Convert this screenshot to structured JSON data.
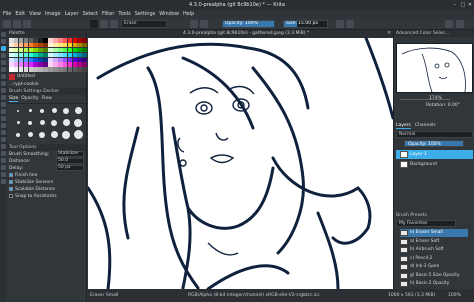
{
  "window": {
    "title": "4.3.0-prealpha (git 8c9b10e) * — Krita"
  },
  "menu": [
    "File",
    "Edit",
    "View",
    "Image",
    "Layer",
    "Select",
    "Filter",
    "Tools",
    "Settings",
    "Window",
    "Help"
  ],
  "toolbar": {
    "blend_mode": "Erase",
    "opacity_label": "Opacity: 100%",
    "opacity_value": 1.0,
    "size_label": "Size: 15.00 px",
    "size_fraction": 0.3
  },
  "left_docker": {
    "palette_title": "Palette",
    "palette_name": "Default",
    "palette_colors": [
      "#e0e0e0",
      "#c0c0c0",
      "#a0a0a0",
      "#808080",
      "#606060",
      "#404040",
      "#202020",
      "#000000",
      "#ffd5d5",
      "#ffaaaa",
      "#ff8080",
      "#ff5555",
      "#ff2a2a",
      "#d40000",
      "#aa0000",
      "#800000",
      "#ffe6d5",
      "#ffccaa",
      "#ffb380",
      "#ff9955",
      "#ff7f2a",
      "#d45500",
      "#aa4400",
      "#803300",
      "#fff6d5",
      "#ffeeaa",
      "#ffe680",
      "#ffdd55",
      "#ffd42a",
      "#d4aa00",
      "#aa8800",
      "#806600",
      "#eeffd5",
      "#ddffaa",
      "#ccff80",
      "#bbff55",
      "#aaff2a",
      "#88d400",
      "#66aa00",
      "#558000",
      "#d5ffd5",
      "#aaffaa",
      "#80ff80",
      "#55ff55",
      "#2aff2a",
      "#00d400",
      "#00aa00",
      "#008000",
      "#d5fff6",
      "#aaffee",
      "#80ffe6",
      "#55ffdd",
      "#2affd5",
      "#00d4aa",
      "#00aa88",
      "#008066",
      "#d5f6ff",
      "#aaeeff",
      "#80e5ff",
      "#55ddff",
      "#2ad4ff",
      "#00aad4",
      "#0088aa",
      "#006680",
      "#d5e5ff",
      "#aaccff",
      "#80b3ff",
      "#5599ff",
      "#2a7fff",
      "#0055d4",
      "#0044aa",
      "#003380",
      "#e5d5ff",
      "#ccaaff",
      "#b380ff",
      "#9955ff",
      "#7f2aff",
      "#5500d4",
      "#4400aa",
      "#330080",
      "#f6d5ff",
      "#eeaaff",
      "#e580ff",
      "#dd55ff",
      "#d42aff",
      "#aa00d4",
      "#8800aa",
      "#660080",
      "#ffd5f6",
      "#ffaaee",
      "#ff80e5",
      "#ff55dd",
      "#ff2ad4",
      "#d400aa",
      "#aa0088",
      "#800066",
      "#ffffff",
      "#f2f2f2",
      "#e6e6e6",
      "#d9d9d9",
      "#cccccc",
      "#bfbfbf",
      "#b3b3b3",
      "#a6a6a6",
      "#999999",
      "#8c8c8c",
      "#808080",
      "#737373",
      "#666666",
      "#595959",
      "#4d4d4d",
      "#404040"
    ],
    "palette_current": "Untitled",
    "palette_file": "...rypt-cookie",
    "brush_docker_title": "Brush Settings Docker",
    "tabs": [
      "Size",
      "Opacity",
      "Flow"
    ],
    "brush_sizes": [
      2,
      3,
      4,
      5,
      6,
      7,
      3,
      4,
      5,
      6,
      7,
      8,
      4,
      5,
      6,
      7,
      8,
      9
    ],
    "tool_options_title": "Tool Options",
    "options": [
      {
        "label": "Brush Smoothing:",
        "value": "Stabilizer"
      },
      {
        "label": "Distance:",
        "value": "50.0"
      },
      {
        "label": "Delay:",
        "value": "50 px"
      },
      {
        "label": "Finish line",
        "value": ""
      },
      {
        "label": "Stabilize Sensors",
        "value": ""
      },
      {
        "label": "Scalable Distance",
        "value": ""
      },
      {
        "label": "Snap to Assistants",
        "value": ""
      }
    ]
  },
  "document": {
    "tab_title": "4.3.0-prealpha (git 8c9b10e) - gathered.jpeg (3.3 MiB) *",
    "close_symbol": "✕"
  },
  "statusbar": {
    "brush": "Eraser Small",
    "color_space": "RGB/Alpha (8-bit integer/channel)  sRGB-elle-V2-srgbtrc.icc",
    "size": "1000 x 563 (3.3 MiB)",
    "zoom": "100%"
  },
  "right_docker": {
    "overview_title": "Overview",
    "color_title": "Advanced Color Selec...",
    "zoom_label": "174%",
    "rotation_label": "Rotation: 0.00°",
    "layers_tabs": [
      "Layers",
      "Channels"
    ],
    "blend_mode": "Normal",
    "layer_opacity_label": "Opacity: 100%",
    "layer_opacity_value": 1.0,
    "layers": [
      {
        "name": "Layer 1",
        "selected": true
      },
      {
        "name": "Background",
        "selected": false
      }
    ],
    "brush_presets_title": "Brush Presets",
    "preset_tag": "My Favorites",
    "presets": [
      {
        "name": "e) Eraser Small",
        "selected": true
      },
      {
        "name": "a) Eraser Soft",
        "selected": false
      },
      {
        "name": "b) Airbrush Soft",
        "selected": false
      },
      {
        "name": "c) Pencil-2",
        "selected": false
      },
      {
        "name": "d) Ink-3 Gpen",
        "selected": false
      },
      {
        "name": "g) Basic-5 Size Opacity",
        "selected": false
      },
      {
        "name": "h) Basic-2 Opacity",
        "selected": false
      }
    ]
  },
  "colors": {
    "accent": "#3daee9",
    "panel": "#31363b",
    "selection": "#3a78ab"
  }
}
